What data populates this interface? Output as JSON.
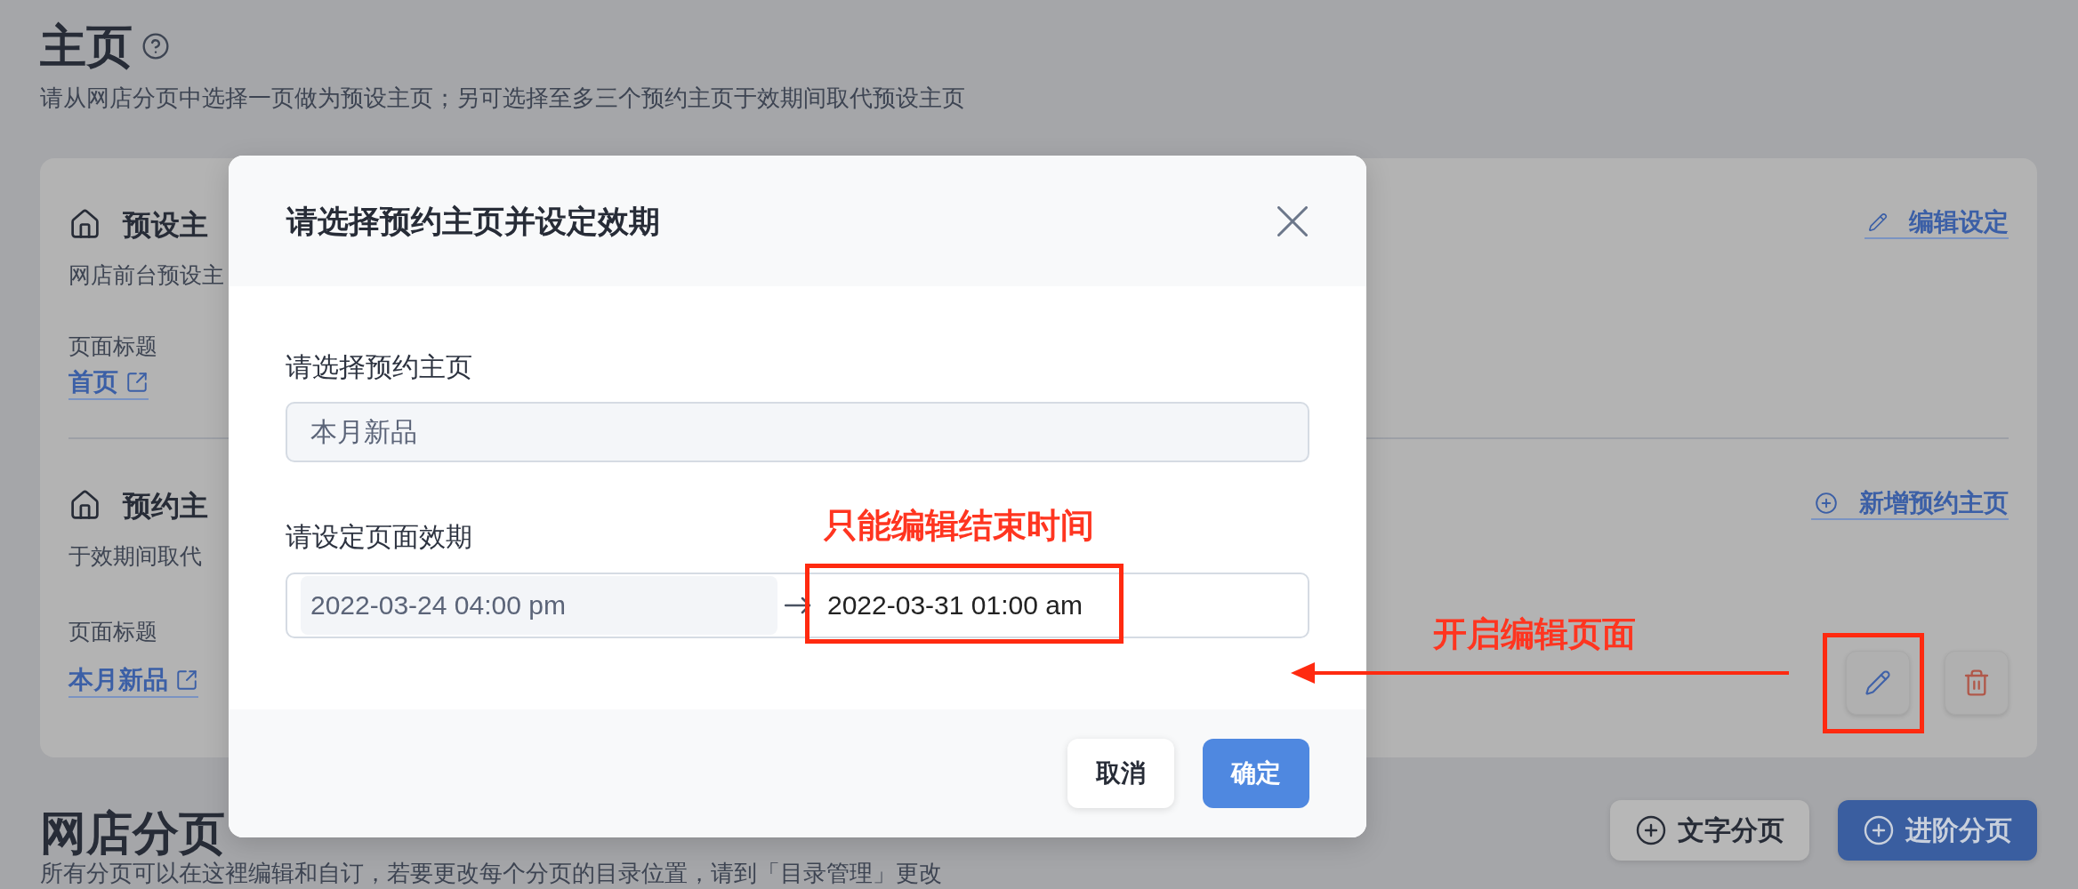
{
  "page": {
    "title": "主页",
    "subtitle": "请从网店分页中选择一页做为预设主页；另可选择至多三个预约主页于效期间取代预设主页"
  },
  "homepage_card": {
    "sections": [
      {
        "title": "预设主",
        "description": "网店前台预设主",
        "field_label": "页面标题",
        "link": "首页",
        "action": {
          "kind": "edit",
          "label": "编辑设定"
        }
      },
      {
        "title": "预约主",
        "description": "于效期间取代",
        "field_label": "页面标题",
        "link": "本月新品",
        "action": {
          "kind": "add",
          "label": "新增预约主页"
        },
        "row_actions": [
          {
            "kind": "edit"
          },
          {
            "kind": "delete"
          }
        ]
      }
    ]
  },
  "pages_section": {
    "title": "网店分页",
    "description": "所有分页可以在这裡编辑和自订，若要更改每个分页的目录位置，请到「目录管理」更改",
    "buttons": [
      {
        "kind": "secondary",
        "label": "文字分页"
      },
      {
        "kind": "primary",
        "label": "进阶分页"
      }
    ]
  },
  "dialog": {
    "title": "请选择预约主页并设定效期",
    "select_label": "请选择预约主页",
    "select": {
      "value": "本月新品",
      "disabled": true
    },
    "date_label": "请设定页面效期",
    "start": {
      "value": "2022-03-24 04:00 pm",
      "disabled": true
    },
    "end": {
      "value": "2022-03-31 01:00 am",
      "disabled": false
    },
    "buttons": [
      {
        "kind": "secondary",
        "label": "取消"
      },
      {
        "kind": "primary",
        "label": "确定"
      }
    ]
  },
  "annotations": [
    {
      "text": "只能编辑结束时间"
    },
    {
      "text": "开启编辑页面"
    }
  ]
}
